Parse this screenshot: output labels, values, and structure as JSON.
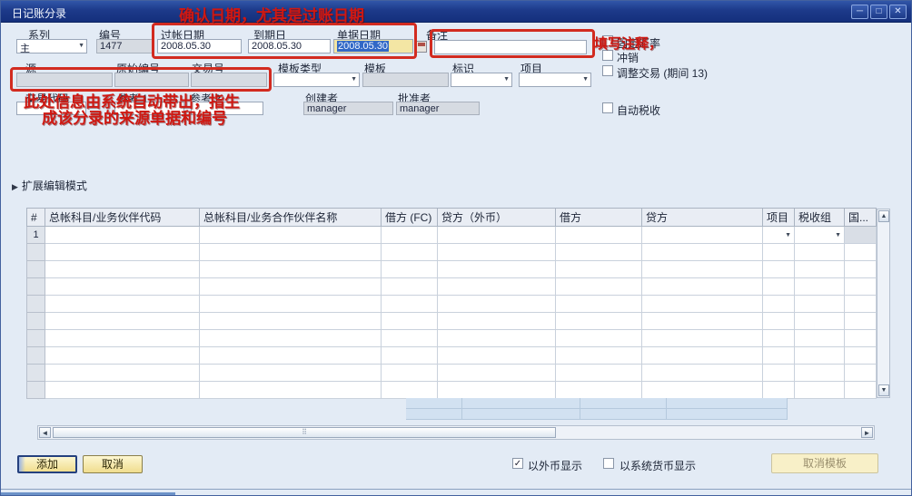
{
  "window": {
    "title": "日记账分录",
    "minimize_glyph": "─",
    "maximize_glyph": "□",
    "close_glyph": "✕"
  },
  "annotations": {
    "title_note": "确认日期，尤其是过账日期",
    "remarks_note": "填写注释，",
    "origin_note_line1": "此处信息由系统自动带出，指生",
    "origin_note_line2": "成该分录的来源单据和编号"
  },
  "form": {
    "series": {
      "label": "系列",
      "value": "主"
    },
    "number": {
      "label": "编号",
      "value": "1477"
    },
    "posting_date": {
      "label": "过帐日期",
      "value": "2008.05.30"
    },
    "due_date": {
      "label": "到期日",
      "value": "2008.05.30"
    },
    "document_date": {
      "label": "单据日期",
      "value": "2008.05.30"
    },
    "remarks": {
      "label": "备注",
      "value": ""
    },
    "origin": {
      "label": "源",
      "value": ""
    },
    "origin_number": {
      "label": "原始编号",
      "value": ""
    },
    "transaction_number": {
      "label": "交易号",
      "value": ""
    },
    "template_type": {
      "label": "模板类型",
      "value": ""
    },
    "template": {
      "label": "模板",
      "value": ""
    },
    "indicator": {
      "label": "标识",
      "value": ""
    },
    "project": {
      "label": "项目",
      "value": ""
    },
    "transaction_code": {
      "label": "交易代码",
      "value": ""
    },
    "reference1": {
      "label": "参考 1",
      "value": ""
    },
    "reference2": {
      "label": "参考 2",
      "value": ""
    },
    "creator": {
      "label": "创建者",
      "value": "manager"
    },
    "approver": {
      "label": "批准者",
      "value": "manager"
    },
    "checkbox_fixed_rate": "固定汇率",
    "checkbox_reverse": "冲销",
    "checkbox_adjust": "调整交易 (期间 13)",
    "checkbox_auto_tax": "自动税收"
  },
  "expand": {
    "label": "扩展编辑模式",
    "arrow": "▶"
  },
  "table": {
    "columns": [
      "#",
      "总帐科目/业务伙伴代码",
      "总帐科目/业务合作伙伴名称",
      "借方 (FC)",
      "贷方（外币）",
      "借方",
      "贷方",
      "项目",
      "税收组",
      "国..."
    ],
    "first_row_number": "1",
    "visible_row_count": 10
  },
  "footer": {
    "add_button": "添加",
    "cancel_button": "取消",
    "display_fc_label": "以外币显示",
    "display_sc_label": "以系统货币显示",
    "cancel_template_button": "取消模板"
  }
}
